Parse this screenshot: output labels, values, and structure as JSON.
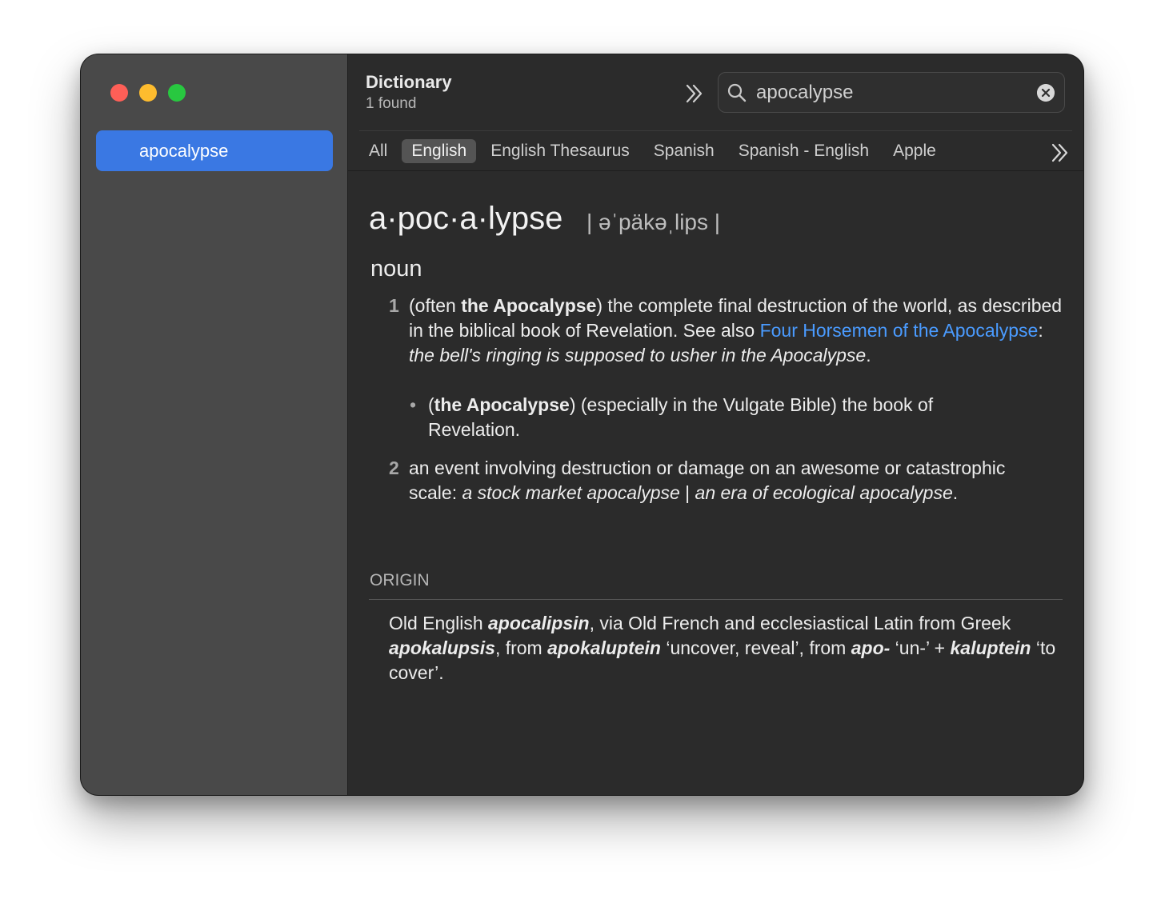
{
  "sidebar": {
    "selected_entry": "apocalypse"
  },
  "header": {
    "title": "Dictionary",
    "subtitle": "1 found"
  },
  "search": {
    "value": "apocalypse"
  },
  "tabs": [
    "All",
    "English",
    "English Thesaurus",
    "Spanish",
    "Spanish - English",
    "Apple"
  ],
  "active_tab": "English",
  "entry": {
    "headword": "a·poc·a·lypse",
    "pronunciation": "| əˈpäkəˌlips |",
    "part_of_speech": "noun",
    "definitions": [
      {
        "number": "1",
        "pre": "(often ",
        "bold": "the Apocalypse",
        "mid": ") the complete final destruction of the world, as described in the biblical book of Revelation. See also ",
        "link": "Four Horsemen of the Apocalypse",
        "colon": ": ",
        "example": "the bell's ringing is supposed to usher in the Apocalypse",
        "end": ".",
        "sub": {
          "bullet": "•",
          "pre": "(",
          "bold": "the Apocalypse",
          "text": ") (especially in the Vulgate Bible) the book of Revelation."
        }
      },
      {
        "number": "2",
        "text": "an event involving destruction or damage on an awesome or catastrophic scale: ",
        "example1": "a stock market apocalypse",
        "sep": " | ",
        "example2": "an era of ecological apocalypse",
        "end": "."
      }
    ],
    "origin": {
      "label": "ORIGIN",
      "t1": "Old English ",
      "w1": "apocalipsin",
      "t2": ", via Old French and ecclesiastical Latin from Greek ",
      "w2": "apokalupsis",
      "t3": ", from ",
      "w3": "apokaluptein",
      "t4": " ‘uncover, reveal’, from ",
      "w4": "apo-",
      "t5": " ‘un-’ + ",
      "w5": "kaluptein",
      "t6": " ‘to cover’."
    }
  },
  "colors": {
    "selection": "#3a78e3",
    "link": "#4a9bff",
    "window_bg": "#2b2b2b",
    "sidebar_bg": "#494949"
  },
  "icons": [
    "close-dot",
    "minimize-dot",
    "zoom-dot",
    "chevron-double-right-icon",
    "search-icon",
    "clear-search-icon"
  ]
}
